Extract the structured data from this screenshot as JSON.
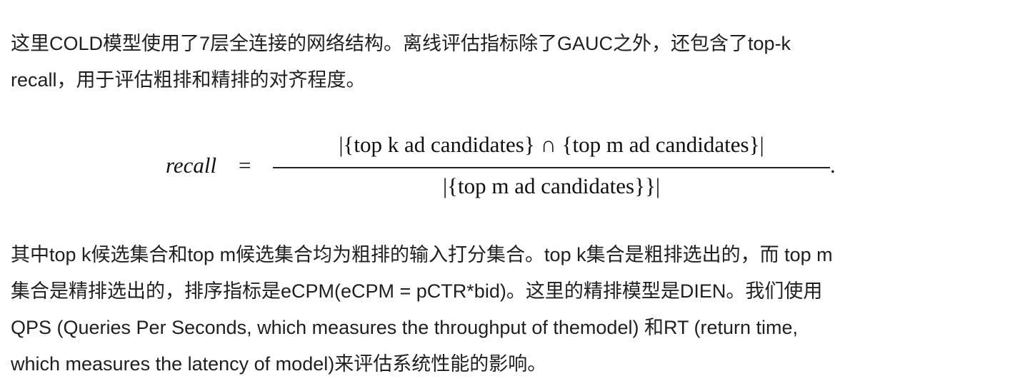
{
  "paragraph1": {
    "lines": [
      "这里COLD模型使用了7层全连接的网络结构。离线评估指标除了GAUC之外，还包含了top-k",
      "recall，用于评估粗排和精排的对齐程度。"
    ]
  },
  "formula": {
    "lhs": "recall",
    "equals": "=",
    "numerator": "|{top k ad candidates} ∩ {top m ad candidates}|",
    "denominator": "|{top m ad candidates}}|",
    "trailing": "."
  },
  "paragraph2": {
    "lines": [
      "其中top k候选集合和top m候选集合均为粗排的输入打分集合。top k集合是粗排选出的，而 top m",
      "集合是精排选出的，排序指标是eCPM(eCPM = pCTR*bid)。这里的精排模型是DIEN。我们使用",
      "QPS (Queries Per Seconds, which measures the throughput of themodel) 和RT (return time,",
      "which measures the latency of model)来评估系统性能的影响。"
    ]
  }
}
